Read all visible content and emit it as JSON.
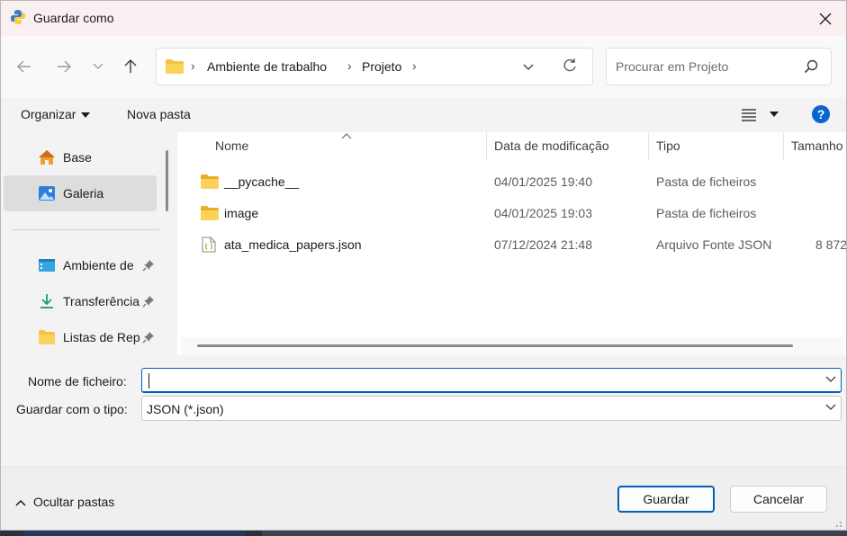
{
  "window": {
    "title": "Guardar como"
  },
  "address": {
    "crumbs": [
      "Ambiente de trabalho",
      "Projeto"
    ]
  },
  "search": {
    "placeholder": "Procurar em Projeto"
  },
  "toolbar": {
    "organize_label": "Organizar",
    "new_folder_label": "Nova pasta",
    "help_label": "?"
  },
  "sidebar": {
    "items": [
      {
        "label": "Base",
        "icon": "home-icon"
      },
      {
        "label": "Galeria",
        "icon": "gallery-icon",
        "selected": true
      },
      {
        "label": "Ambiente de",
        "icon": "desktop-icon",
        "pinned": true
      },
      {
        "label": "Transferência",
        "icon": "download-icon",
        "pinned": true
      },
      {
        "label": "Listas de Rep",
        "icon": "folder-icon",
        "pinned": true
      }
    ]
  },
  "columns": {
    "name": "Nome",
    "date": "Data de modificação",
    "type": "Tipo",
    "size": "Tamanho"
  },
  "files": [
    {
      "name": "__pycache__",
      "date": "04/01/2025 19:40",
      "type": "Pasta de ficheiros",
      "size": "",
      "icon": "folder-icon"
    },
    {
      "name": "image",
      "date": "04/01/2025 19:03",
      "type": "Pasta de ficheiros",
      "size": "",
      "icon": "folder-icon"
    },
    {
      "name": "ata_medica_papers.json",
      "date": "07/12/2024 21:48",
      "type": "Arquivo Fonte JSON",
      "size": "8 872",
      "icon": "json-file-icon"
    }
  ],
  "form": {
    "filename_label": "Nome de ficheiro:",
    "filename_value": "",
    "filetype_label": "Guardar com o tipo:",
    "filetype_value": "JSON (*.json)"
  },
  "footer": {
    "hide_folders_label": "Ocultar pastas",
    "save_label": "Guardar",
    "cancel_label": "Cancelar"
  },
  "colors": {
    "accent": "#005fb8",
    "folder": "#f5c242",
    "titlebar": "#fbf0f1"
  }
}
